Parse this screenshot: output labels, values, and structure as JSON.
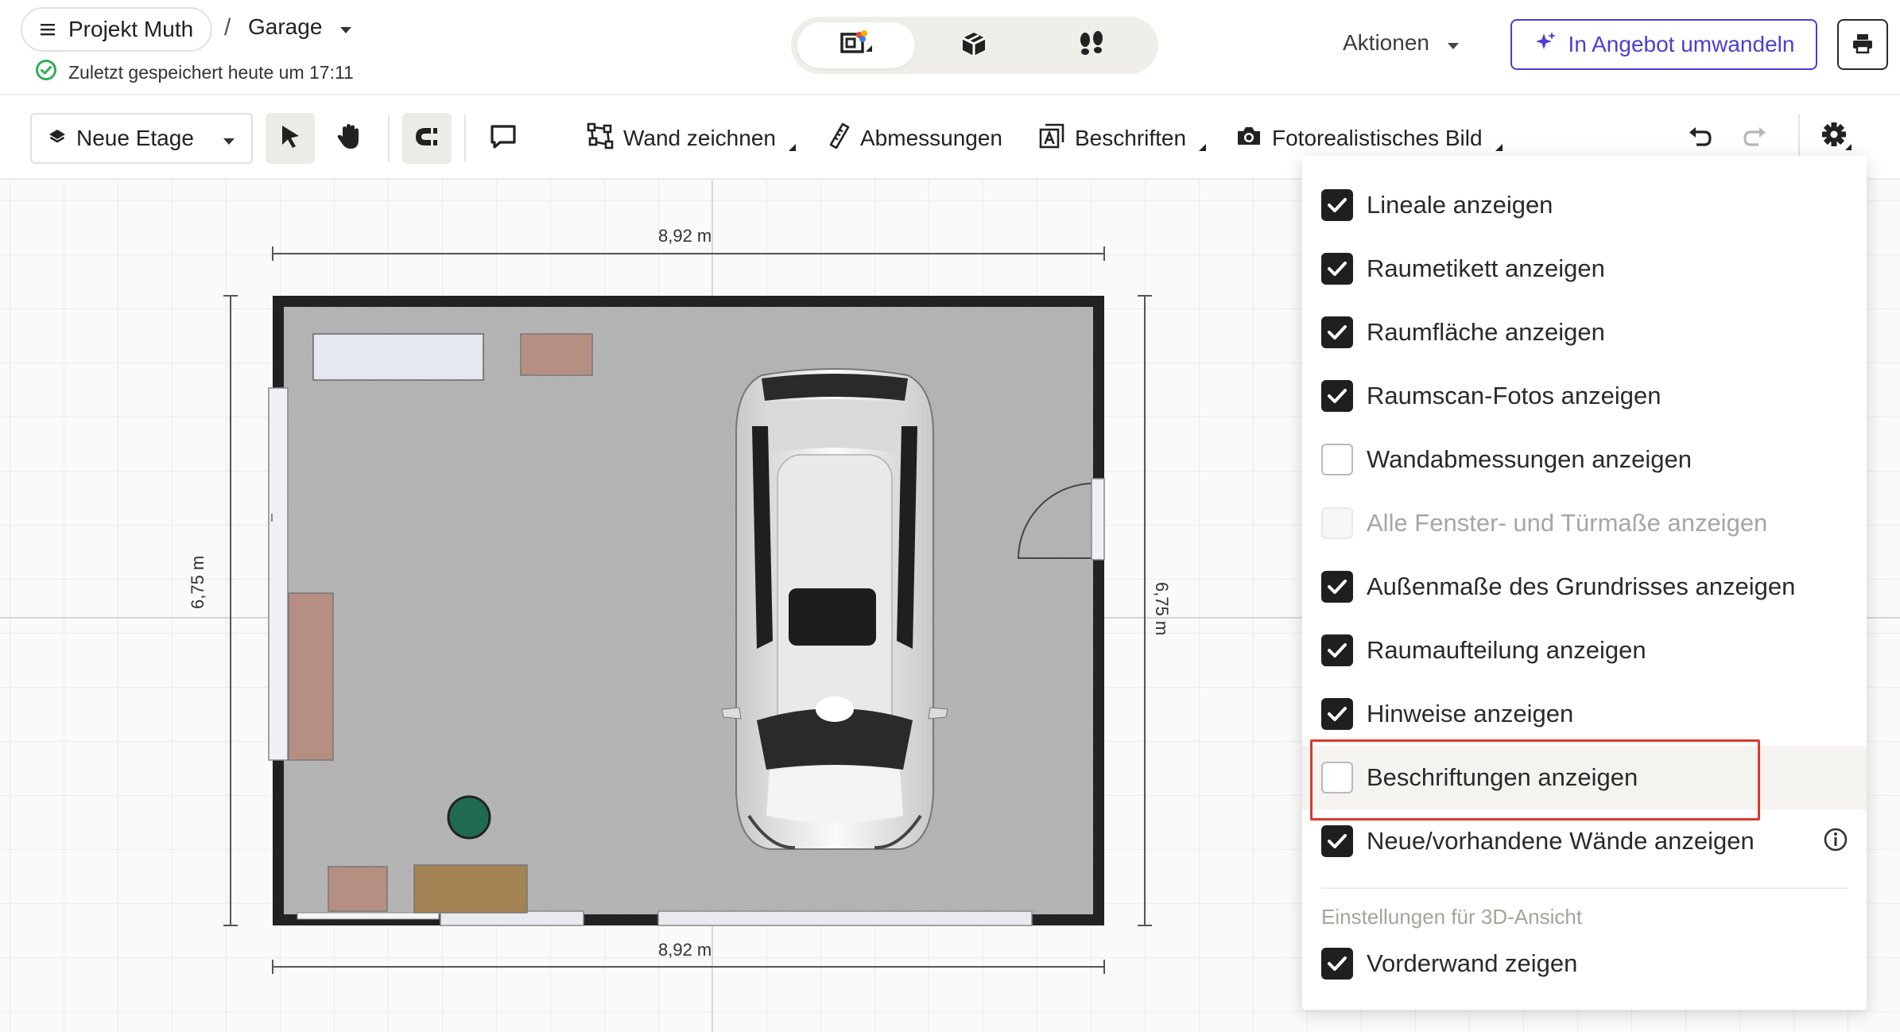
{
  "header": {
    "project_label": "Projekt Muth",
    "separator": "/",
    "current_room": "Garage",
    "save_status": "Zuletzt gespeichert heute um 17:11",
    "view_modes": [
      "2d-plan-icon",
      "3d-box-icon",
      "walkthrough-icon"
    ],
    "actions_label": "Aktionen",
    "offer_button": "In Angebot umwandeln"
  },
  "toolbar": {
    "floor_select": "Neue Etage",
    "draw_wall": "Wand zeichnen",
    "dimensions": "Abmessungen",
    "labels": "Beschriften",
    "photo": "Fotorealistisches Bild"
  },
  "plan": {
    "dim_top": "8,92 m",
    "dim_bottom": "8,92 m",
    "dim_left": "6,75 m",
    "dim_right": "6,75 m"
  },
  "menu": {
    "items": [
      {
        "label": "Lineale anzeigen",
        "state": "checked"
      },
      {
        "label": "Raumetikett anzeigen",
        "state": "checked"
      },
      {
        "label": "Raumfläche anzeigen",
        "state": "checked"
      },
      {
        "label": "Raumscan-Fotos anzeigen",
        "state": "checked"
      },
      {
        "label": "Wandabmessungen anzeigen",
        "state": "unchecked"
      },
      {
        "label": "Alle Fenster- und Türmaße anzeigen",
        "state": "disabled"
      },
      {
        "label": "Außenmaße des Grundrisses anzeigen",
        "state": "checked"
      },
      {
        "label": "Raumaufteilung anzeigen",
        "state": "checked"
      },
      {
        "label": "Hinweise anzeigen",
        "state": "checked"
      },
      {
        "label": "Beschriftungen anzeigen",
        "state": "unchecked"
      },
      {
        "label": "Neue/vorhandene Wände anzeigen",
        "state": "checked"
      }
    ],
    "section_title": "Einstellungen für 3D-Ansicht",
    "section_items": [
      {
        "label": "Vorderwand zeigen",
        "state": "checked"
      }
    ]
  },
  "colors": {
    "accent": "#4a3fd1",
    "highlight": "#d93a2c",
    "success": "#2fae5a",
    "checkbox": "#1f1f1f"
  }
}
